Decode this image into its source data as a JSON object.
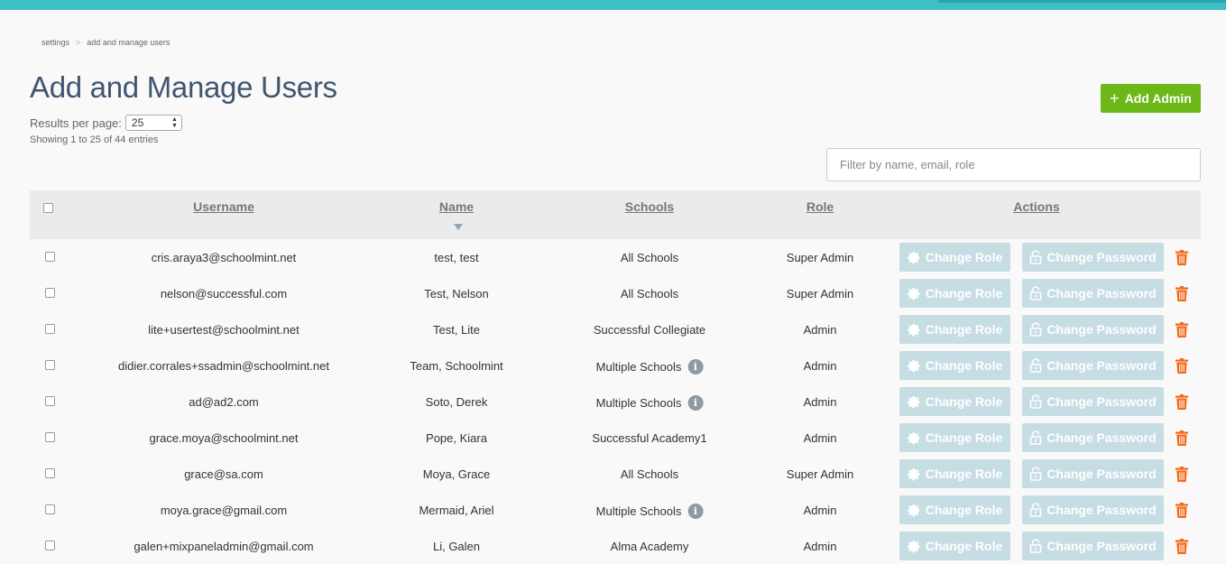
{
  "breadcrumb": {
    "root": "settings",
    "separator": ">",
    "current": "add and manage users"
  },
  "page_title": "Add and Manage Users",
  "results_per_page": {
    "label": "Results per page:",
    "value": "25"
  },
  "showing": "Showing 1 to 25 of 44 entries",
  "add_admin_label": "Add Admin",
  "filter": {
    "placeholder": "Filter by name, email, role"
  },
  "columns": {
    "username": "Username",
    "name": "Name",
    "schools": "Schools",
    "role": "Role",
    "actions": "Actions"
  },
  "actions": {
    "change_role": "Change Role",
    "change_password": "Change Password"
  },
  "rows": [
    {
      "username": "cris.araya3@schoolmint.net",
      "name": "test, test",
      "schools": "All Schools",
      "info": false,
      "role": "Super Admin"
    },
    {
      "username": "nelson@successful.com",
      "name": "Test, Nelson",
      "schools": "All Schools",
      "info": false,
      "role": "Super Admin"
    },
    {
      "username": "lite+usertest@schoolmint.net",
      "name": "Test, Lite",
      "schools": "Successful Collegiate",
      "info": false,
      "role": "Admin"
    },
    {
      "username": "didier.corrales+ssadmin@schoolmint.net",
      "name": "Team, Schoolmint",
      "schools": "Multiple Schools",
      "info": true,
      "role": "Admin"
    },
    {
      "username": "ad@ad2.com",
      "name": "Soto, Derek",
      "schools": "Multiple Schools",
      "info": true,
      "role": "Admin"
    },
    {
      "username": "grace.moya@schoolmint.net",
      "name": "Pope, Kiara",
      "schools": "Successful Academy1",
      "info": false,
      "role": "Admin"
    },
    {
      "username": "grace@sa.com",
      "name": "Moya, Grace",
      "schools": "All Schools",
      "info": false,
      "role": "Super Admin"
    },
    {
      "username": "moya.grace@gmail.com",
      "name": "Mermaid, Ariel",
      "schools": "Multiple Schools",
      "info": true,
      "role": "Admin"
    },
    {
      "username": "galen+mixpaneladmin@gmail.com",
      "name": "Li, Galen",
      "schools": "Alma Academy",
      "info": false,
      "role": "Admin"
    }
  ],
  "colors": {
    "accent": "#3ebfc6",
    "add_button": "#6db819",
    "action_button": "#c6dde4",
    "trash": "#f26a1b",
    "title": "#3f5670"
  }
}
